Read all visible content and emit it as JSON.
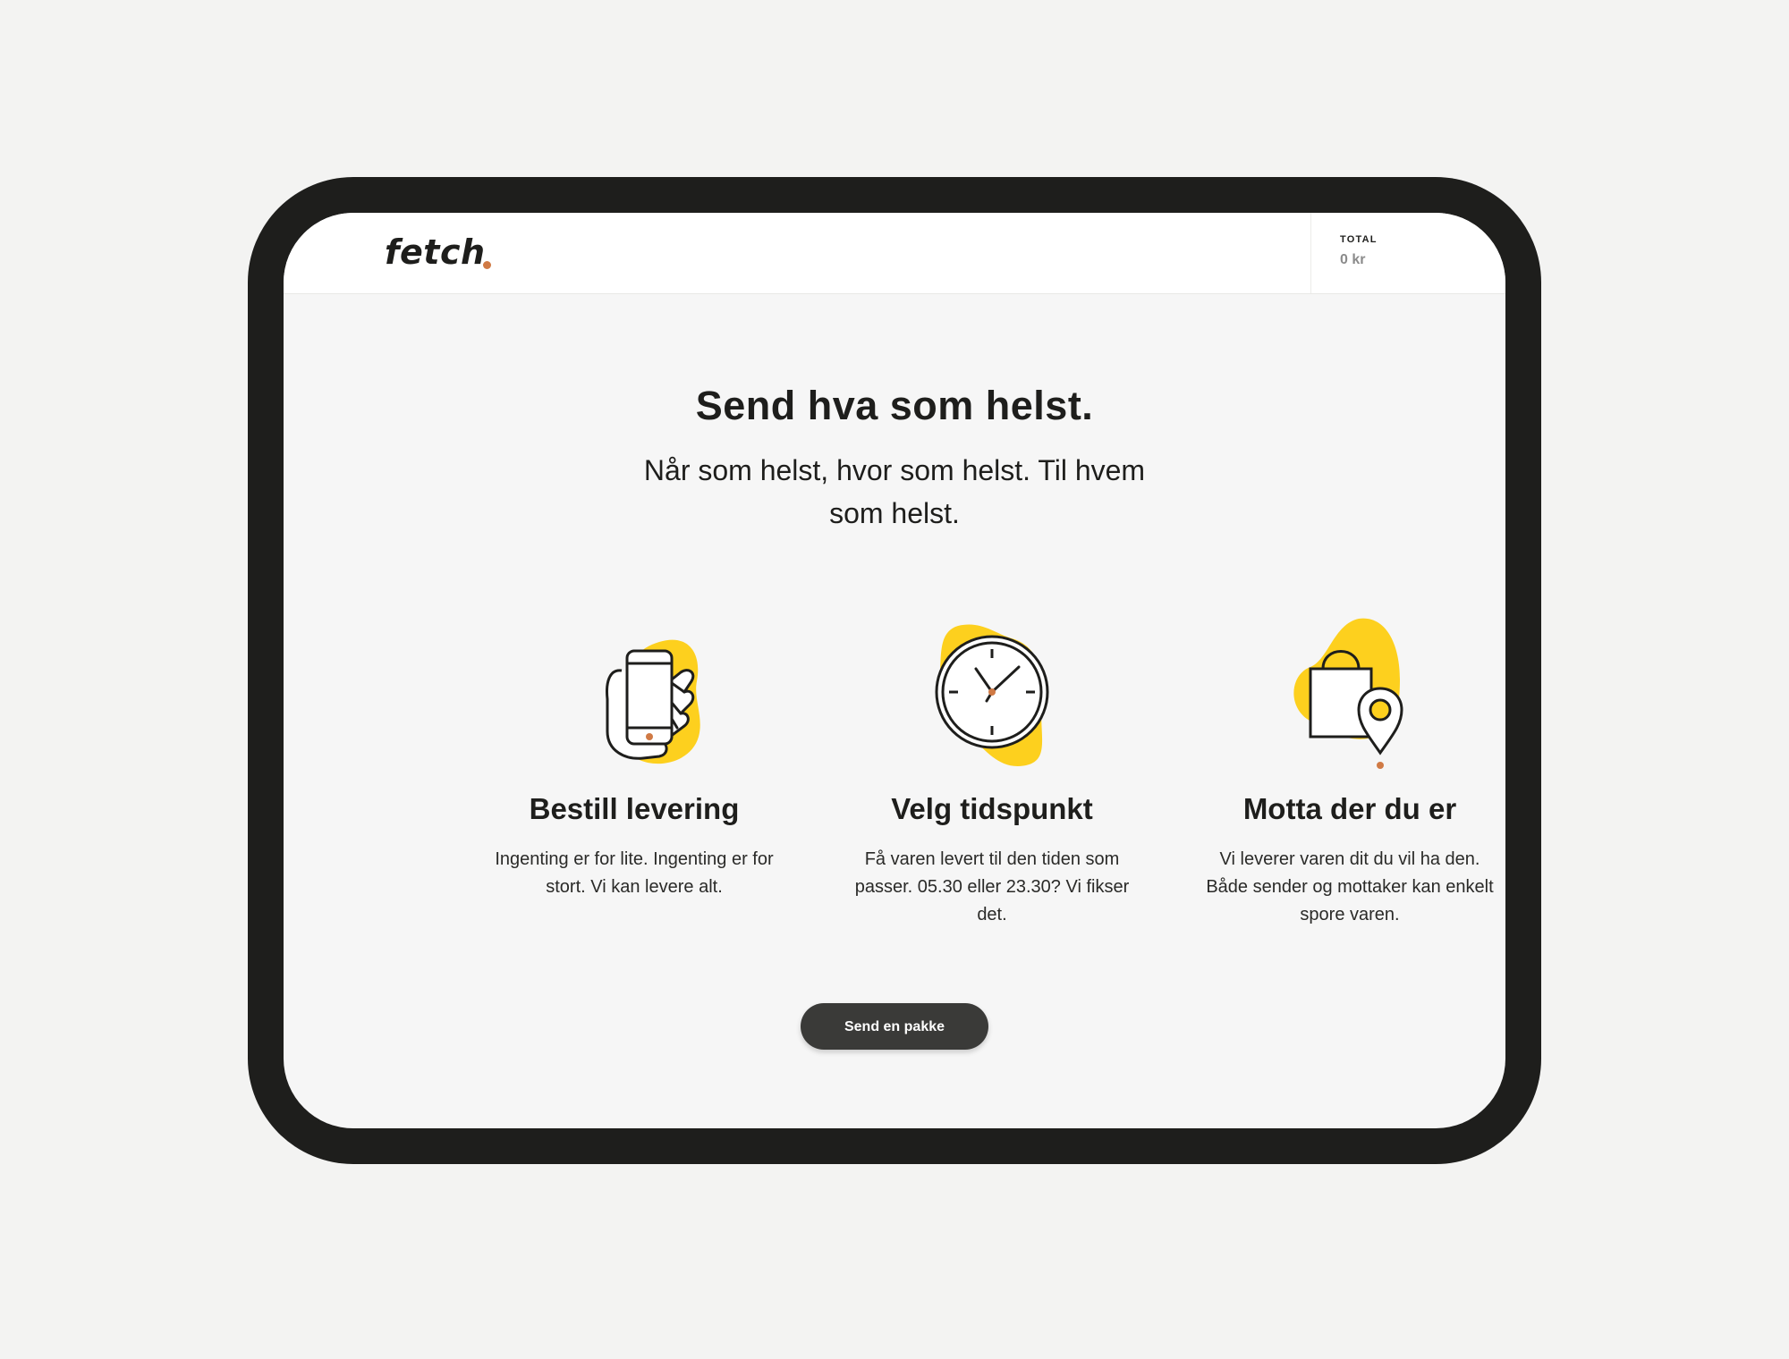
{
  "app": {
    "brand": "fetch"
  },
  "header": {
    "total_label": "TOTAL",
    "total_value": "0 kr"
  },
  "hero": {
    "title": "Send hva som helst.",
    "subtitle": "Når som helst, hvor som helst. Til hvem som helst."
  },
  "features": [
    {
      "icon": "phone-in-hand-icon",
      "title": "Bestill levering",
      "text": "Ingenting er for lite. Ingenting er for stort. Vi kan levere alt."
    },
    {
      "icon": "clock-icon",
      "title": "Velg tidspunkt",
      "text": "Få varen levert til den tiden som passer. 05.30 eller 23.30? Vi fikser det."
    },
    {
      "icon": "shopping-bag-location-icon",
      "title": "Motta der du er",
      "text": "Vi leverer varen dit du vil ha den. Både sender og mottaker kan enkelt spore varen."
    }
  ],
  "cta": {
    "label": "Send en pakke"
  },
  "colors": {
    "accent_yellow": "#fdd01e",
    "accent_orange": "#d07a45",
    "dark": "#1e1e1c",
    "button": "#3a3a38"
  }
}
